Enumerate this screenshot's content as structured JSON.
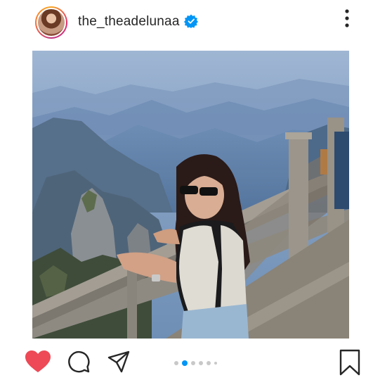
{
  "post": {
    "username": "the_theadelunaa",
    "verified": true,
    "avatar_icon": "profile-avatar",
    "more_icon": "more-vertical-icon"
  },
  "photo": {
    "subject": "travel photo"
  },
  "actions": {
    "like_icon": "heart-filled-icon",
    "comment_icon": "comment-icon",
    "share_icon": "send-icon",
    "save_icon": "bookmark-icon",
    "like_color": "#ed4956"
  },
  "carousel": {
    "total": 6,
    "current": 2,
    "active_color": "#0095f6"
  }
}
